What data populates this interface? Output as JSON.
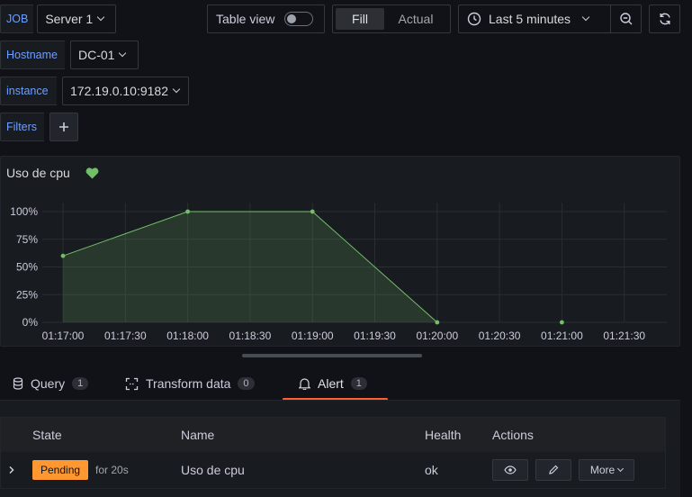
{
  "variables": {
    "job": {
      "label": "JOB",
      "value": "Server 1"
    },
    "hostname": {
      "label": "Hostname",
      "value": "DC-01"
    },
    "instance": {
      "label": "instance",
      "value": "172.19.0.10:9182"
    },
    "filters": {
      "label": "Filters",
      "add_icon": "plus-icon"
    }
  },
  "toolbar": {
    "table_view_label": "Table view",
    "table_view_on": false,
    "fill_label": "Fill",
    "actual_label": "Actual",
    "time_range": "Last 5 minutes",
    "zoom_out_icon": "zoom-out-icon",
    "refresh_icon": "refresh-icon"
  },
  "panel": {
    "title": "Uso de cpu",
    "health_icon": "heart-icon",
    "health_color": "#73bf69"
  },
  "chart_data": {
    "type": "area",
    "title": "Uso de cpu",
    "x": [
      "01:17:00",
      "01:18:00",
      "01:19:00",
      "01:20:00",
      "01:21:00"
    ],
    "x_ticks": [
      "01:17:00",
      "01:17:30",
      "01:18:00",
      "01:18:30",
      "01:19:00",
      "01:19:30",
      "01:20:00",
      "01:20:30",
      "01:21:00",
      "01:21:30"
    ],
    "y_ticks": [
      "0%",
      "25%",
      "50%",
      "75%",
      "100%"
    ],
    "series": [
      {
        "values": [
          60,
          100,
          100,
          0,
          0
        ],
        "color": "#73bf69"
      }
    ],
    "ylim": [
      0,
      100
    ],
    "grid": true
  },
  "tabs": [
    {
      "label": "Query",
      "count": "1",
      "icon": "database-icon",
      "active": false
    },
    {
      "label": "Transform data",
      "count": "0",
      "icon": "transform-icon",
      "active": false
    },
    {
      "label": "Alert",
      "count": "1",
      "icon": "bell-icon",
      "active": true
    }
  ],
  "alerts": {
    "headers": {
      "state": "State",
      "name": "Name",
      "health": "Health",
      "actions": "Actions"
    },
    "rows": [
      {
        "state": "Pending",
        "duration": "for 20s",
        "name": "Uso de cpu",
        "health": "ok",
        "more": "More"
      }
    ]
  },
  "colors": {
    "accent": "#ff5f2e",
    "pending": "#ff9830",
    "series": "#73bf69"
  }
}
